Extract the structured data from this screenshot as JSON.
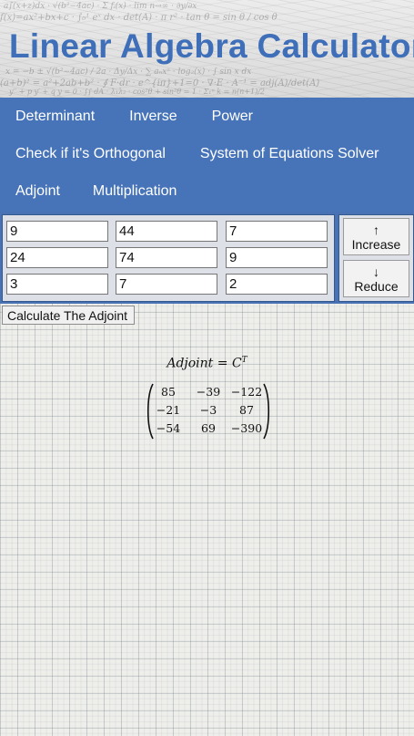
{
  "header": {
    "title": "Linear Algebra Calculator"
  },
  "nav": {
    "rows": [
      [
        "Determinant",
        "Inverse",
        "Power"
      ],
      [
        "Check if it's Orthogonal",
        "System of Equations Solver"
      ],
      [
        "Adjoint",
        "Multiplication"
      ]
    ]
  },
  "matrix": {
    "inputs": [
      [
        "9",
        "44",
        "7"
      ],
      [
        "24",
        "74",
        "9"
      ],
      [
        "3",
        "7",
        "2"
      ]
    ]
  },
  "controls": {
    "increase_arrow": "↑",
    "increase_label": "Increase",
    "reduce_arrow": "↓",
    "reduce_label": "Reduce",
    "calculate_label": "Calculate The Adjoint"
  },
  "result": {
    "label": "Adjoint",
    "equals": "=",
    "base": "C",
    "superscript": "T",
    "matrix": [
      [
        "85",
        "−39",
        "−122"
      ],
      [
        "−21",
        "−3",
        "87"
      ],
      [
        "−54",
        "69",
        "−390"
      ]
    ]
  }
}
